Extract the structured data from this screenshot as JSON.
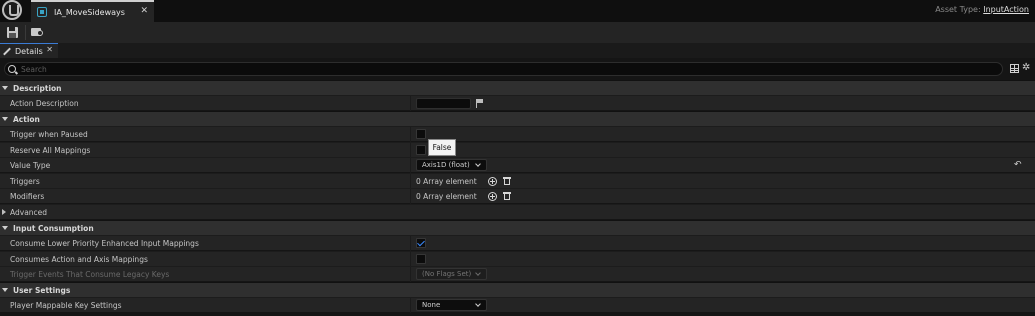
{
  "window": {
    "tab_title": "IA_MoveSideways",
    "tab_close_glyph": "✕",
    "asset_type_label": "Asset Type:",
    "asset_type_value": "InputAction"
  },
  "toolbar": {
    "save_icon": "floppy-disk",
    "browse_icon": "folder-search"
  },
  "details_tab": {
    "label": "Details",
    "close_glyph": "✕"
  },
  "search": {
    "placeholder": "Search"
  },
  "reset_glyph": "↶",
  "gear_glyph": "✲",
  "sections": {
    "description": "Description",
    "action": "Action",
    "input_consumption": "Input Consumption",
    "user_settings": "User Settings"
  },
  "rows": {
    "action_description": {
      "label": "Action Description",
      "value": ""
    },
    "trigger_when_paused": {
      "label": "Trigger when Paused",
      "checked": false
    },
    "reserve_all_mappings": {
      "label": "Reserve All Mappings",
      "checked": false
    },
    "value_type": {
      "label": "Value Type",
      "value": "Axis1D (float)"
    },
    "triggers": {
      "label": "Triggers",
      "value": "0 Array element"
    },
    "modifiers": {
      "label": "Modifiers",
      "value": "0 Array element"
    },
    "advanced": {
      "label": "Advanced"
    },
    "consume_lower_priority": {
      "label": "Consume Lower Priority Enhanced Input Mappings",
      "checked": true
    },
    "consumes_action_axis": {
      "label": "Consumes Action and Axis Mappings",
      "checked": false
    },
    "trigger_events_legacy": {
      "label": "Trigger Events That Consume Legacy Keys",
      "value": "(No Flags Set)"
    },
    "player_mappable": {
      "label": "Player Mappable Key Settings",
      "value": "None"
    }
  },
  "tooltip": {
    "text": "False"
  },
  "colors": {
    "checkbox_check": "#3a8bff",
    "tab_accent": "#3a7bd5",
    "asset_icon": "#3aa3c4"
  }
}
